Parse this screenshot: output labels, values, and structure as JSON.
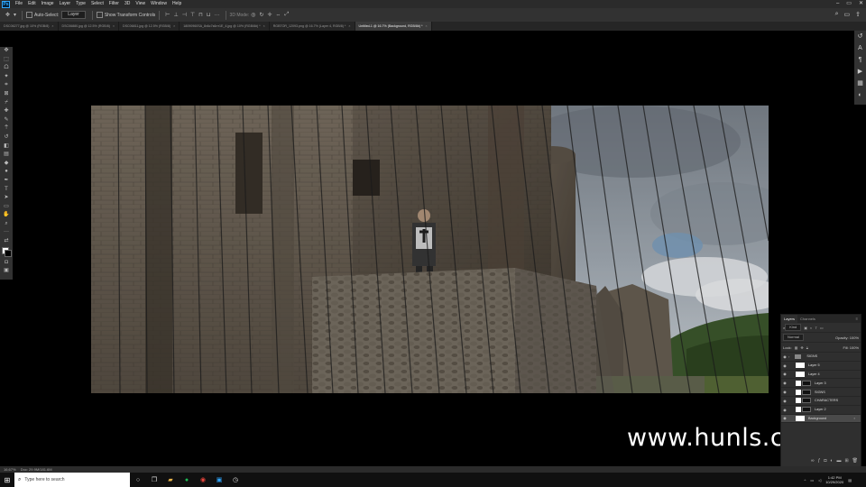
{
  "menubar": {
    "app_icon": "Ps",
    "items": [
      "File",
      "Edit",
      "Image",
      "Layer",
      "Type",
      "Select",
      "Filter",
      "3D",
      "View",
      "Window",
      "Help"
    ],
    "controls": [
      "–",
      "▭",
      "✕"
    ]
  },
  "options": {
    "auto_select_label": "Auto-Select:",
    "layer_dropdown": "Layer",
    "transform_label": "Show Transform Controls",
    "mode_label": "3D Mode:"
  },
  "tabs": [
    {
      "label": "DSC06277.jpg @ 10% (RGB/8)",
      "active": false
    },
    {
      "label": "DSC06880.jpg @ 12.5% (RGB/8)",
      "active": false
    },
    {
      "label": "DSC06811.jpg @ 12.5% (RGB/8)",
      "active": false
    },
    {
      "label": "18090960SA_8x6c7s6rrr1E_4.jpg @ 10% (RGB/8#) *",
      "active": false
    },
    {
      "label": "RGBTOR_12093.png @ 16.7% (Layer 4, RGB/8) *",
      "active": false
    },
    {
      "label": "Untitled-1 @ 16.7% (Background, RGB/8#) *",
      "active": true
    }
  ],
  "layers_panel": {
    "tabs": [
      "Layers",
      "Channels"
    ],
    "filter_label": "Kind",
    "mode_label": "Normal",
    "opacity_label": "Opacity: 100%",
    "lock_label": "Lock:",
    "fill_label": "Fill: 100%",
    "layers": [
      {
        "name": "SIGNS",
        "kind": "group",
        "selected": false
      },
      {
        "name": "Layer 5",
        "kind": "white",
        "selected": false
      },
      {
        "name": "Layer 4",
        "kind": "white",
        "selected": false
      },
      {
        "name": "Layer 3",
        "kind": "mask",
        "selected": false
      },
      {
        "name": "SIGNS",
        "kind": "mask",
        "selected": false
      },
      {
        "name": "CHARACTERS",
        "kind": "mask",
        "selected": false
      },
      {
        "name": "Layer 2",
        "kind": "mask",
        "selected": false
      },
      {
        "name": "Background",
        "kind": "white",
        "selected": true
      }
    ]
  },
  "watermark": "www.hunls.com",
  "status": {
    "zoom": "16.67%",
    "doc": "Doc: 29.9M/181.6M"
  },
  "taskbar": {
    "search_placeholder": "Type here to search",
    "time": "1:42 PM",
    "date": "10/29/2020"
  }
}
